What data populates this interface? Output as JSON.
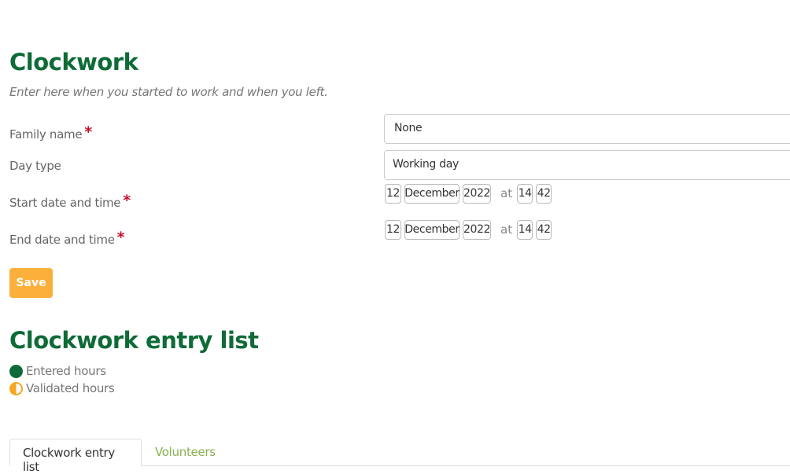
{
  "form": {
    "title": "Clockwork",
    "subtitle": "Enter here when you started to work and when you left.",
    "family_name": {
      "label": "Family name",
      "required_mark": "*",
      "value": "None"
    },
    "day_type": {
      "label": "Day type",
      "value": "Working day"
    },
    "start": {
      "label": "Start date and time",
      "required_mark": "*",
      "day": "12",
      "month": "December",
      "year": "2022",
      "at": "at",
      "hour": "14",
      "minute": "42"
    },
    "end": {
      "label": "End date and time",
      "required_mark": "*",
      "day": "12",
      "month": "December",
      "year": "2022",
      "at": "at",
      "hour": "14",
      "minute": "42"
    },
    "save_label": "Save"
  },
  "entry_list": {
    "title": "Clockwork entry list",
    "legend": [
      {
        "label": "Entered hours",
        "icon": "filled-circle-icon",
        "color": "#0e6b37"
      },
      {
        "label": "Validated hours",
        "icon": "half-circle-icon",
        "color": "#f5a623"
      }
    ],
    "tabs": [
      {
        "label": "Clockwork entry list",
        "active": true
      },
      {
        "label": "Volunteers",
        "active": false
      }
    ]
  },
  "colors": {
    "heading": "#0e6b37",
    "save_button": "#fbb03b",
    "required": "#c8102e",
    "tab_link": "#8bb14f"
  }
}
